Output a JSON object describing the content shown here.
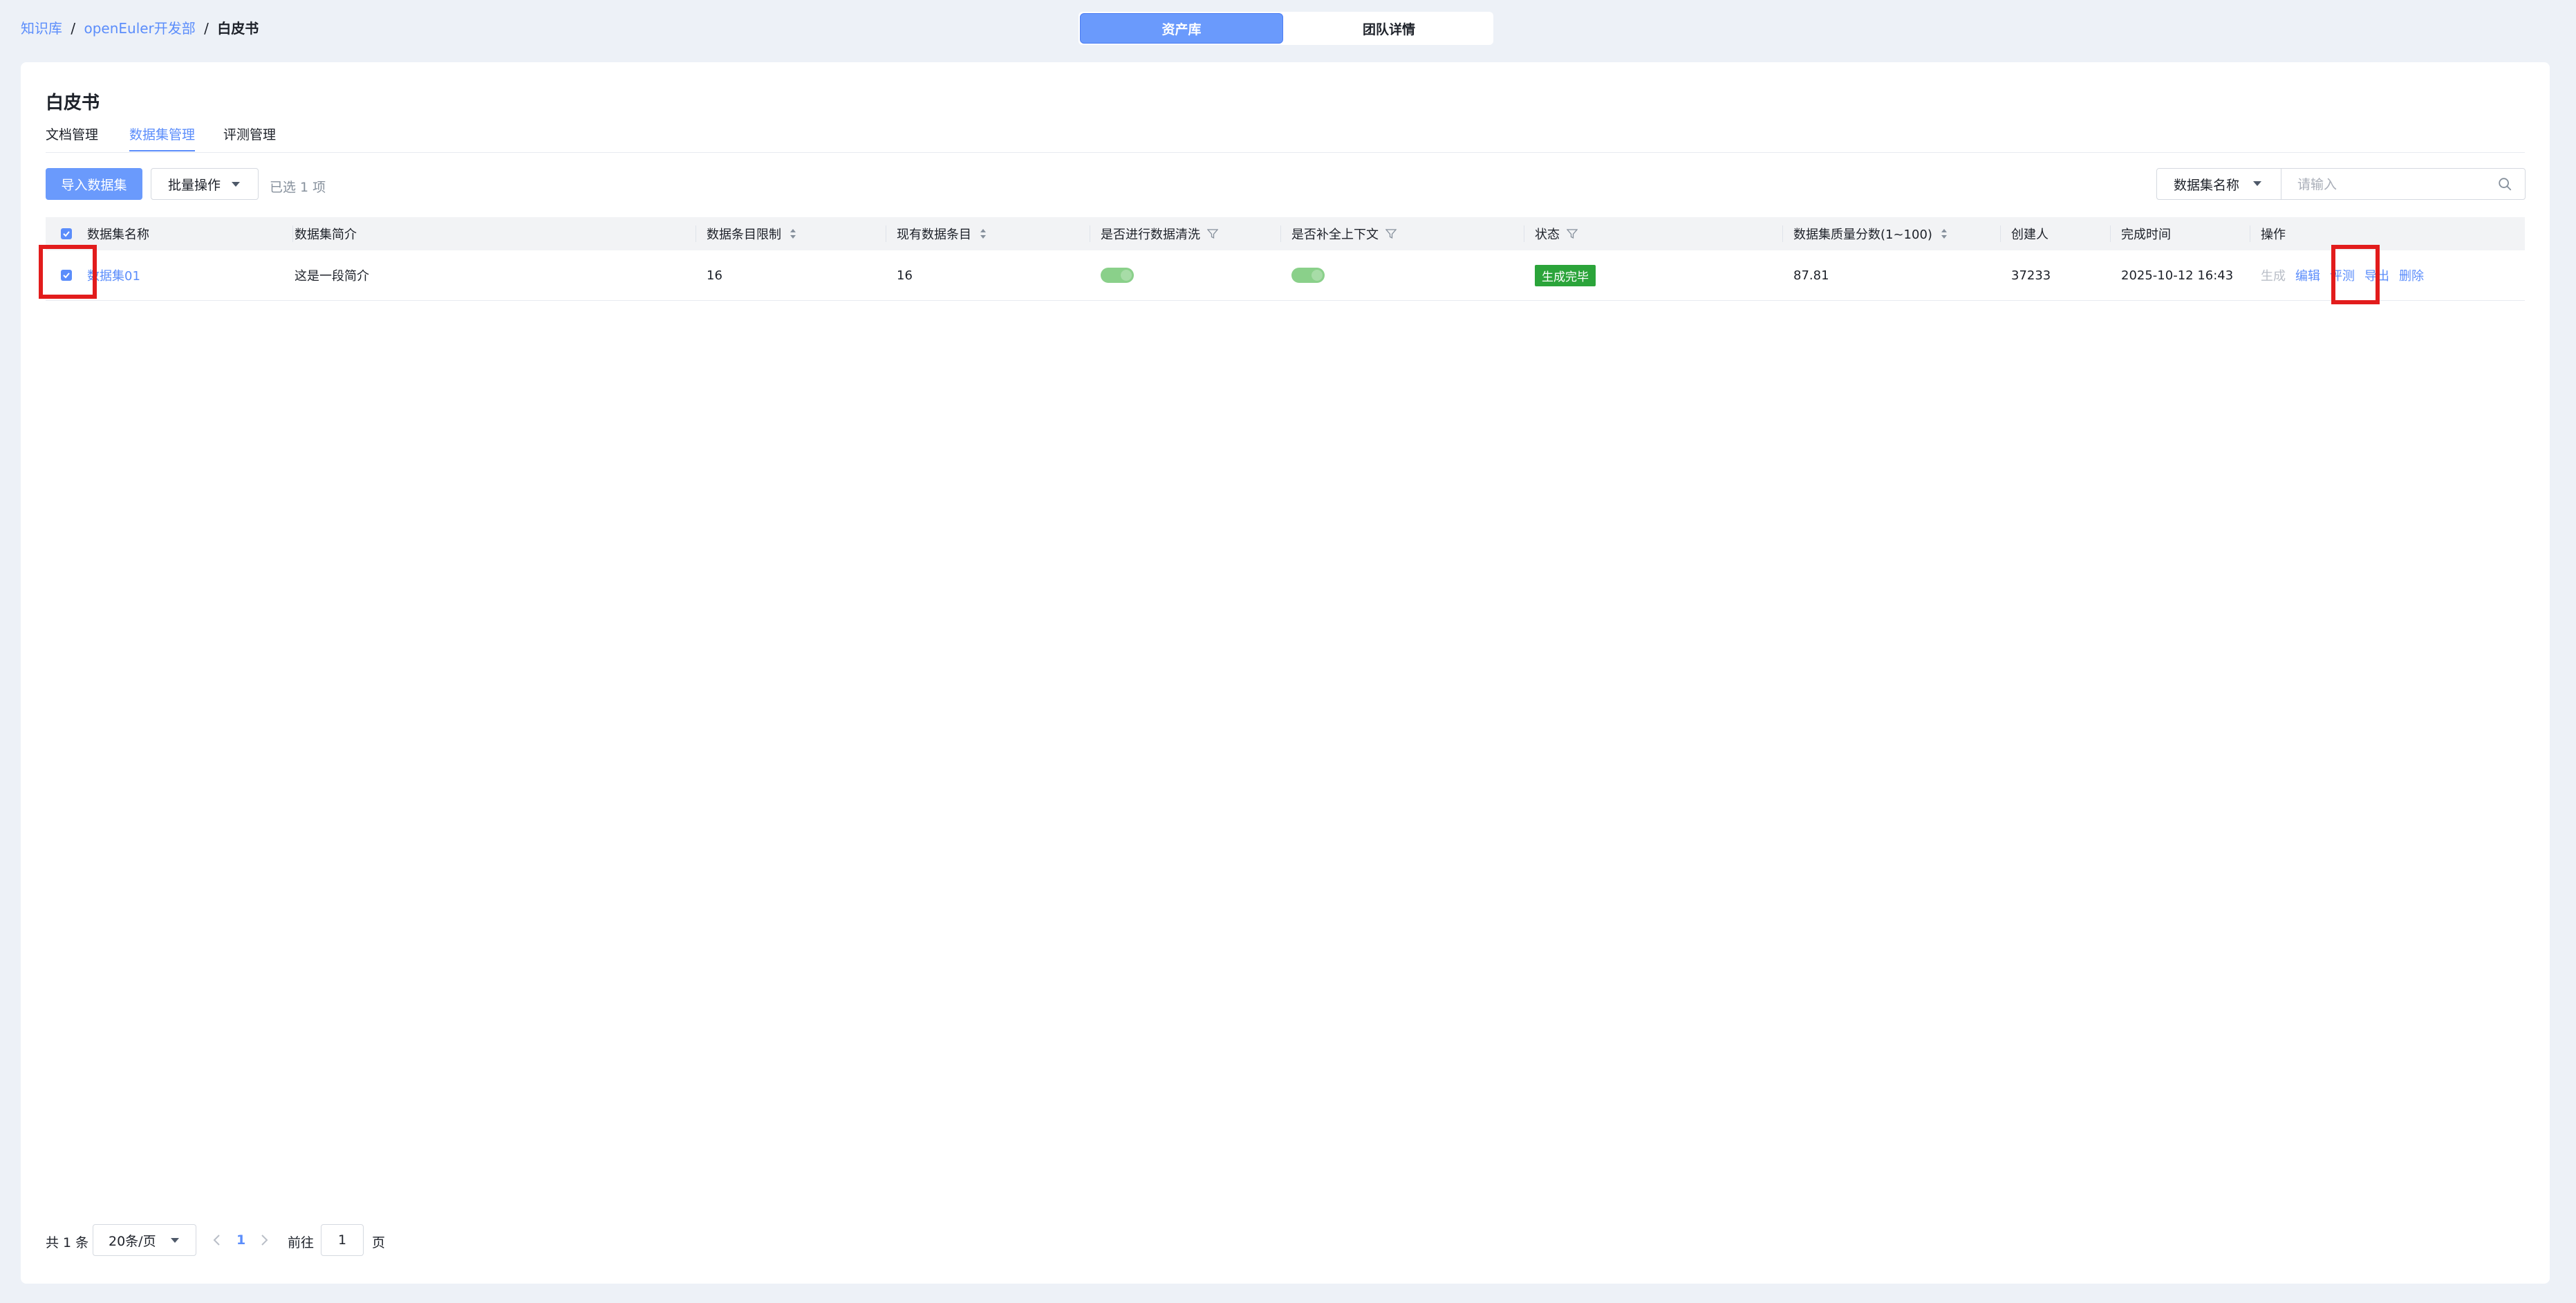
{
  "breadcrumb": {
    "root": "知识库",
    "team": "openEuler开发部",
    "current": "白皮书",
    "separator": "/"
  },
  "switcher": {
    "active": "资产库",
    "inactive": "团队详情"
  },
  "page": {
    "title": "白皮书"
  },
  "tabs": [
    {
      "label": "文档管理"
    },
    {
      "label": "数据集管理"
    },
    {
      "label": "评测管理"
    }
  ],
  "toolbar": {
    "import_label": "导入数据集",
    "batch_label": "批量操作",
    "selected_text": "已选 1 项",
    "search_field": "数据集名称",
    "search_placeholder": "请输入"
  },
  "table": {
    "headers": {
      "name": "数据集名称",
      "intro": "数据集简介",
      "limit": "数据条目限制",
      "count": "现有数据条目",
      "clean": "是否进行数据清洗",
      "context": "是否补全上下文",
      "status": "状态",
      "score": "数据集质量分数(1~100)",
      "creator": "创建人",
      "time": "完成时间",
      "ops": "操作"
    },
    "rows": [
      {
        "name": "数据集01",
        "intro": "这是一段简介",
        "limit": "16",
        "count": "16",
        "clean": true,
        "context": true,
        "status": "生成完毕",
        "score": "87.81",
        "creator": "37233",
        "time": "2025-10-12 16:43",
        "actions": {
          "generate": "生成",
          "edit": "编辑",
          "evaluate": "评测",
          "export": "导出",
          "delete": "删除"
        }
      }
    ]
  },
  "pagination": {
    "total_text": "共 1 条",
    "page_size": "20条/页",
    "current_page": "1",
    "goto_label": "前往",
    "goto_value": "1",
    "page_suffix": "页"
  },
  "colors": {
    "accent": "#5b8dfb",
    "primary_button": "#6a9afc",
    "status_success": "#2ba43a",
    "highlight_box": "#e21c1c",
    "background": "#edf1f7"
  },
  "icons": {
    "search": "search-icon",
    "sort": "sort-icon",
    "filter": "filter-icon",
    "caret": "chevron-down-icon"
  }
}
